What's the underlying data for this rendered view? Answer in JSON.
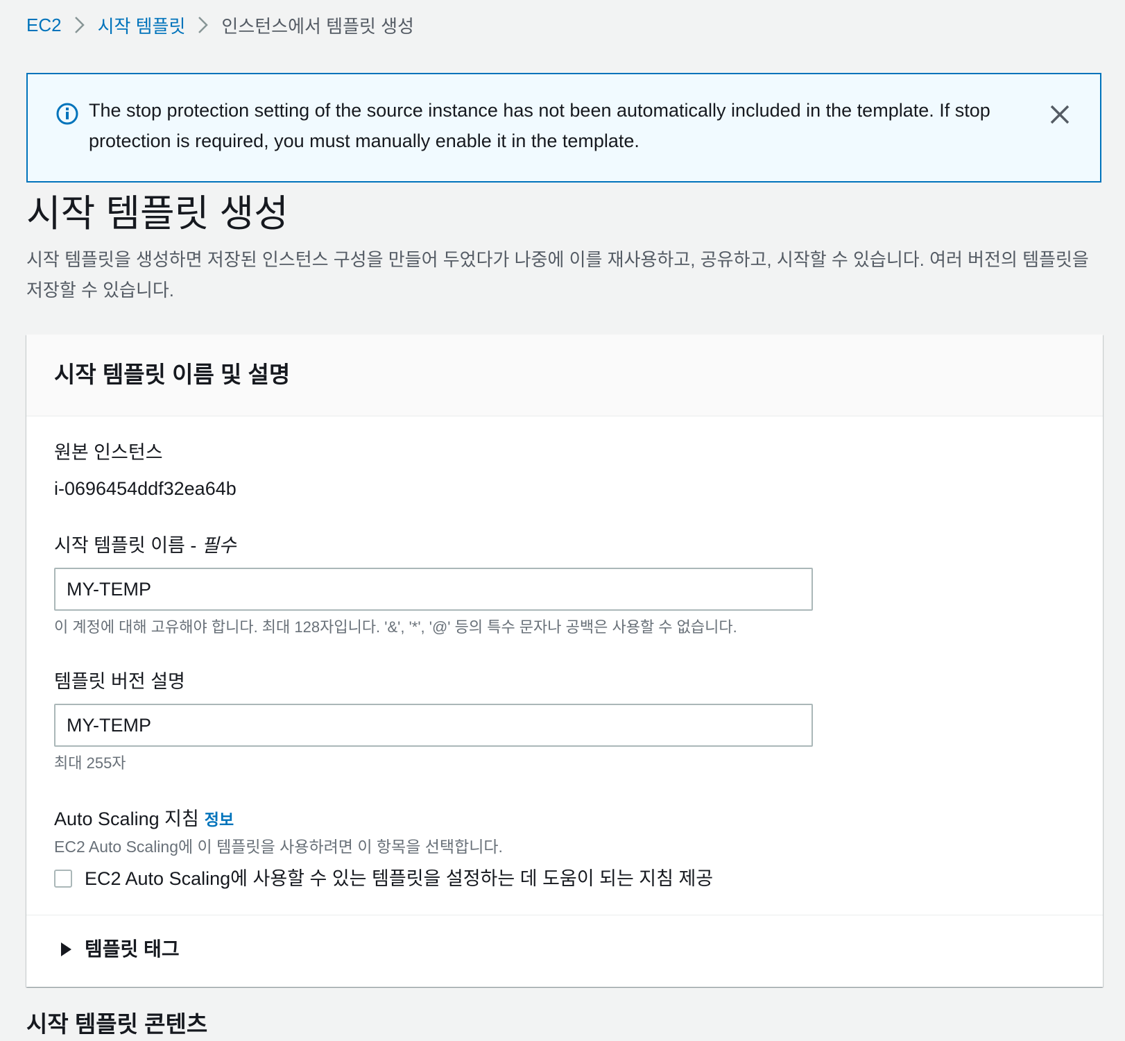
{
  "breadcrumb": {
    "items": [
      "EC2",
      "시작 템플릿",
      "인스턴스에서 템플릿 생성"
    ]
  },
  "alert": {
    "text": "The stop protection setting of the source instance has not been automatically included in the template. If stop protection is required, you must manually enable it in the template.",
    "icon": "info-icon",
    "accent_color": "#0073bb",
    "background_color": "#f1faff"
  },
  "page": {
    "title": "시작 템플릿 생성",
    "description": "시작 템플릿을 생성하면 저장된 인스턴스 구성을 만들어 두었다가 나중에 이를 재사용하고, 공유하고, 시작할 수 있습니다. 여러 버전의 템플릿을 저장할 수 있습니다."
  },
  "panel": {
    "title": "시작 템플릿 이름 및 설명",
    "source_instance": {
      "label": "원본 인스턴스",
      "value": "i-0696454ddf32ea64b"
    },
    "template_name": {
      "label": "시작 템플릿 이름 -",
      "required": "필수",
      "value": "MY-TEMP",
      "hint": "이 계정에 대해 고유해야 합니다. 최대 128자입니다. '&', '*', '@' 등의 특수 문자나 공백은 사용할 수 없습니다."
    },
    "version_description": {
      "label": "템플릿 버전 설명",
      "value": "MY-TEMP",
      "hint": "최대 255자"
    },
    "auto_scaling": {
      "label": "Auto Scaling 지침",
      "info_link": "정보",
      "description": "EC2 Auto Scaling에 이 템플릿을 사용하려면 이 항목을 선택합니다.",
      "checkbox_label": "EC2 Auto Scaling에 사용할 수 있는 템플릿을 설정하는 데 도움이 되는 지침 제공",
      "checked": false
    },
    "tags_expander": {
      "label": "템플릿 태그",
      "expanded": false
    }
  },
  "next_section": {
    "title": "시작 템플릿 콘텐츠"
  },
  "colors": {
    "link": "#0073bb",
    "page_background": "#f2f3f3",
    "input_border": "#aab7b8"
  }
}
